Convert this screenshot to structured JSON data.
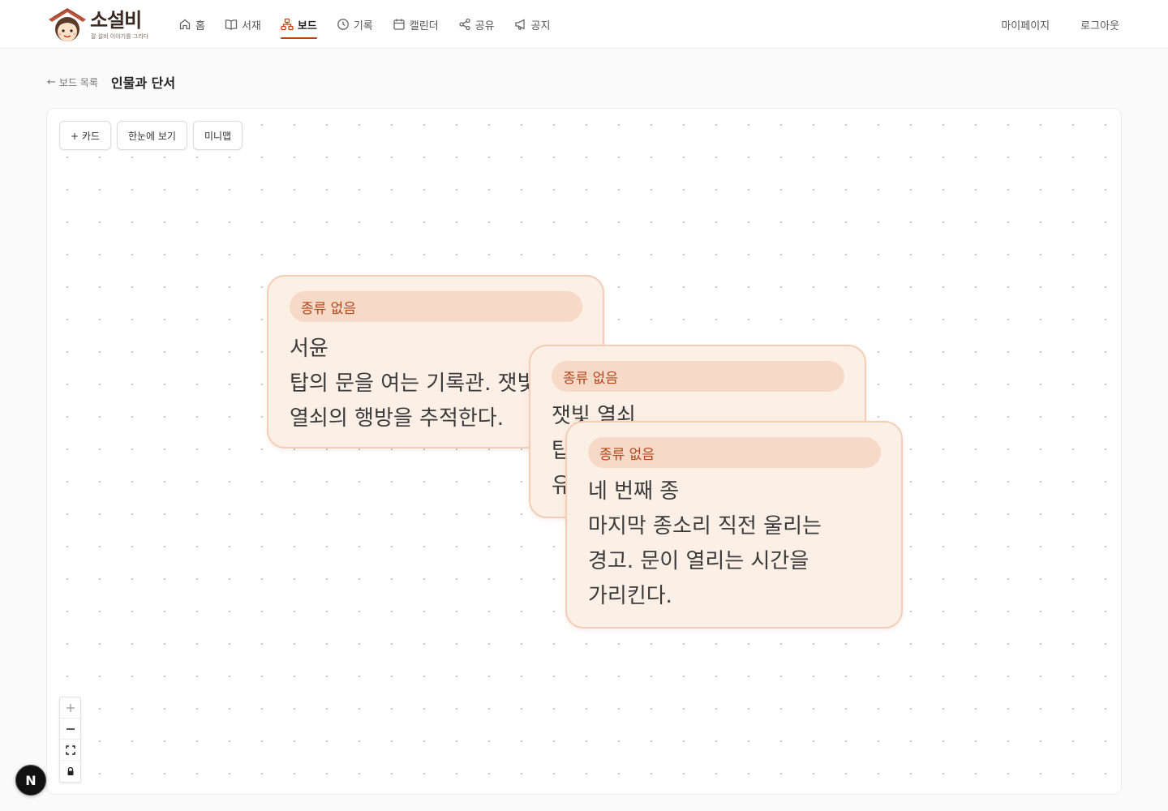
{
  "brand": {
    "title": "소설비",
    "tagline": "잘 설비 이야기를 그리다"
  },
  "nav": [
    {
      "label": "홈",
      "icon": "home-icon",
      "active": false
    },
    {
      "label": "서재",
      "icon": "book-icon",
      "active": false
    },
    {
      "label": "보드",
      "icon": "board-icon",
      "active": true
    },
    {
      "label": "기록",
      "icon": "clock-icon",
      "active": false
    },
    {
      "label": "캘린더",
      "icon": "calendar-icon",
      "active": false
    },
    {
      "label": "공유",
      "icon": "share-icon",
      "active": false
    },
    {
      "label": "공지",
      "icon": "megaphone-icon",
      "active": false
    }
  ],
  "header_right": {
    "mypage": "마이페이지",
    "logout": "로그아웃"
  },
  "breadcrumb": {
    "back": "보드 목록",
    "title": "인물과 단서"
  },
  "toolbar": {
    "add_card": "+ 카드",
    "overview": "한눈에 보기",
    "minimap": "미니맵"
  },
  "cards": [
    {
      "tag": "종류 없음",
      "text": "서윤\n탑의 문을 여는 기록관. 잿빛\n열쇠의 행방을 추적한다."
    },
    {
      "tag": "종류 없음",
      "text": "잿빛 열쇠\n탑\n유"
    },
    {
      "tag": "종류 없음",
      "text": "네 번째 종\n마지막 종소리 직전 울리는\n경고. 문이 열리는 시간을\n가리킨다."
    }
  ],
  "zoom_controls": [
    "plus-icon",
    "minus-icon",
    "fit-view-icon",
    "lock-icon"
  ],
  "badge": "N",
  "colors": {
    "accent": "#c2410c",
    "card_bg": "#fcefe6",
    "card_border": "#f4cdb6",
    "tag_bg": "#f6d9c6",
    "tag_text": "#b4451d"
  }
}
